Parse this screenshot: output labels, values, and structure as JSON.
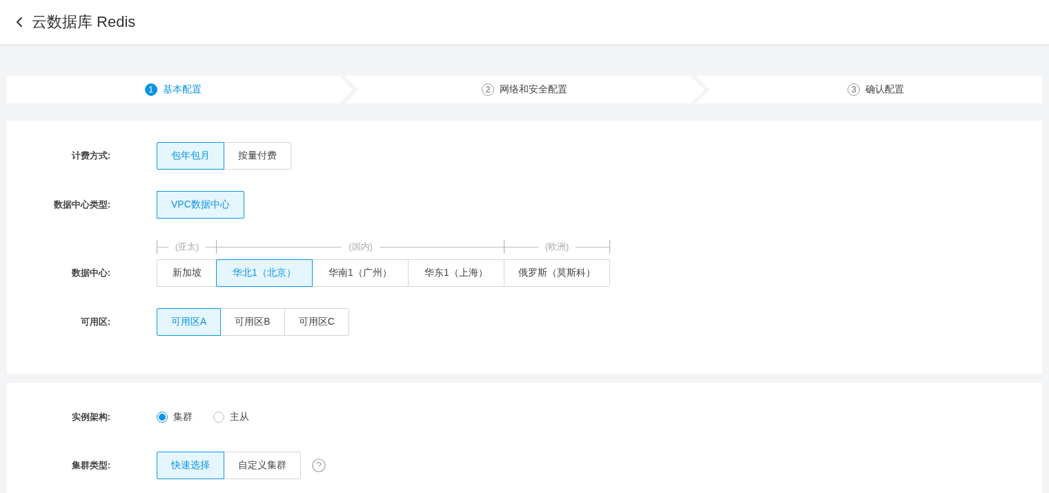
{
  "header": {
    "title": "云数据库 Redis"
  },
  "steps": [
    {
      "number": "1",
      "label": "基本配置",
      "selected": true
    },
    {
      "number": "2",
      "label": "网络和安全配置",
      "selected": false
    },
    {
      "number": "3",
      "label": "确认配置",
      "selected": false
    }
  ],
  "basic_card": {
    "rows": [
      {
        "kind": "segmented",
        "label": "计费方式:",
        "options": [
          {
            "label": "包年包月",
            "selected": true
          },
          {
            "label": "按量付费",
            "selected": false
          }
        ]
      },
      {
        "kind": "segmented",
        "label": "数据中心类型:",
        "options": [
          {
            "label": "VPC数据中心",
            "selected": true
          }
        ]
      },
      {
        "kind": "regions",
        "label": "数据中心:",
        "regions": [
          {
            "name": "(亚太)",
            "options": [
              {
                "label": "新加坡",
                "selected": false
              }
            ]
          },
          {
            "name": "(国内)",
            "options": [
              {
                "label": "华北1（北京）",
                "selected": true
              },
              {
                "label": "华南1（广州）",
                "selected": false
              },
              {
                "label": "华东1（上海）",
                "selected": false
              }
            ]
          },
          {
            "name": "(欧洲)",
            "options": [
              {
                "label": "俄罗斯（莫斯科）",
                "selected": false
              }
            ]
          }
        ]
      },
      {
        "kind": "segmented",
        "label": "可用区:",
        "options": [
          {
            "label": "可用区A",
            "selected": true
          },
          {
            "label": "可用区B",
            "selected": false
          },
          {
            "label": "可用区C",
            "selected": false
          }
        ]
      }
    ]
  },
  "cluster_card": {
    "rows": [
      {
        "kind": "radio",
        "label": "实例架构:",
        "options": [
          {
            "label": "集群",
            "selected": true
          },
          {
            "label": "主从",
            "selected": false
          }
        ]
      },
      {
        "kind": "segmented",
        "label": "集群类型:",
        "help": true,
        "options": [
          {
            "label": "快速选择",
            "selected": true
          },
          {
            "label": "自定义集群",
            "selected": false
          }
        ]
      }
    ]
  }
}
